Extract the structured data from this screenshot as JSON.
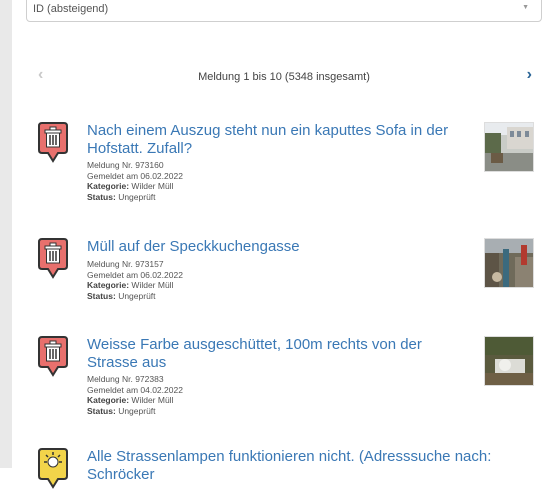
{
  "sort": {
    "selected": "ID (absteigend)"
  },
  "pager": {
    "prev_icon": "chevron-left-icon",
    "next_icon": "chevron-right-icon",
    "info": "Meldung 1 bis 10 (5348 insgesamt)"
  },
  "labels": {
    "kategorie": "Kategorie:",
    "status": "Status:"
  },
  "reports": [
    {
      "title": "Nach einem Auszug steht nun ein kaputtes Sofa in der Hofstatt. Zufall?",
      "nr": "Meldung Nr. 973160",
      "date": "Gemeldet am 06.02.2022",
      "kategorie": "Wilder Müll",
      "status": "Ungeprüft",
      "icon": "trash-icon"
    },
    {
      "title": "Müll auf der Speckkuchengasse",
      "nr": "Meldung Nr. 973157",
      "date": "Gemeldet am 06.02.2022",
      "kategorie": "Wilder Müll",
      "status": "Ungeprüft",
      "icon": "trash-icon"
    },
    {
      "title": "Weisse Farbe ausgeschüttet, 100m rechts von der Strasse aus",
      "nr": "Meldung Nr. 972383",
      "date": "Gemeldet am 04.02.2022",
      "kategorie": "Wilder Müll",
      "status": "Ungeprüft",
      "icon": "trash-icon"
    },
    {
      "title": "Alle Strassenlampen funktionieren nicht. (Adresssuche nach: Schröcker",
      "icon": "streetlamp-icon"
    }
  ],
  "colors": {
    "link": "#3a78b5",
    "pin_red": "#e8706d",
    "pin_yellow": "#f2d44a"
  }
}
